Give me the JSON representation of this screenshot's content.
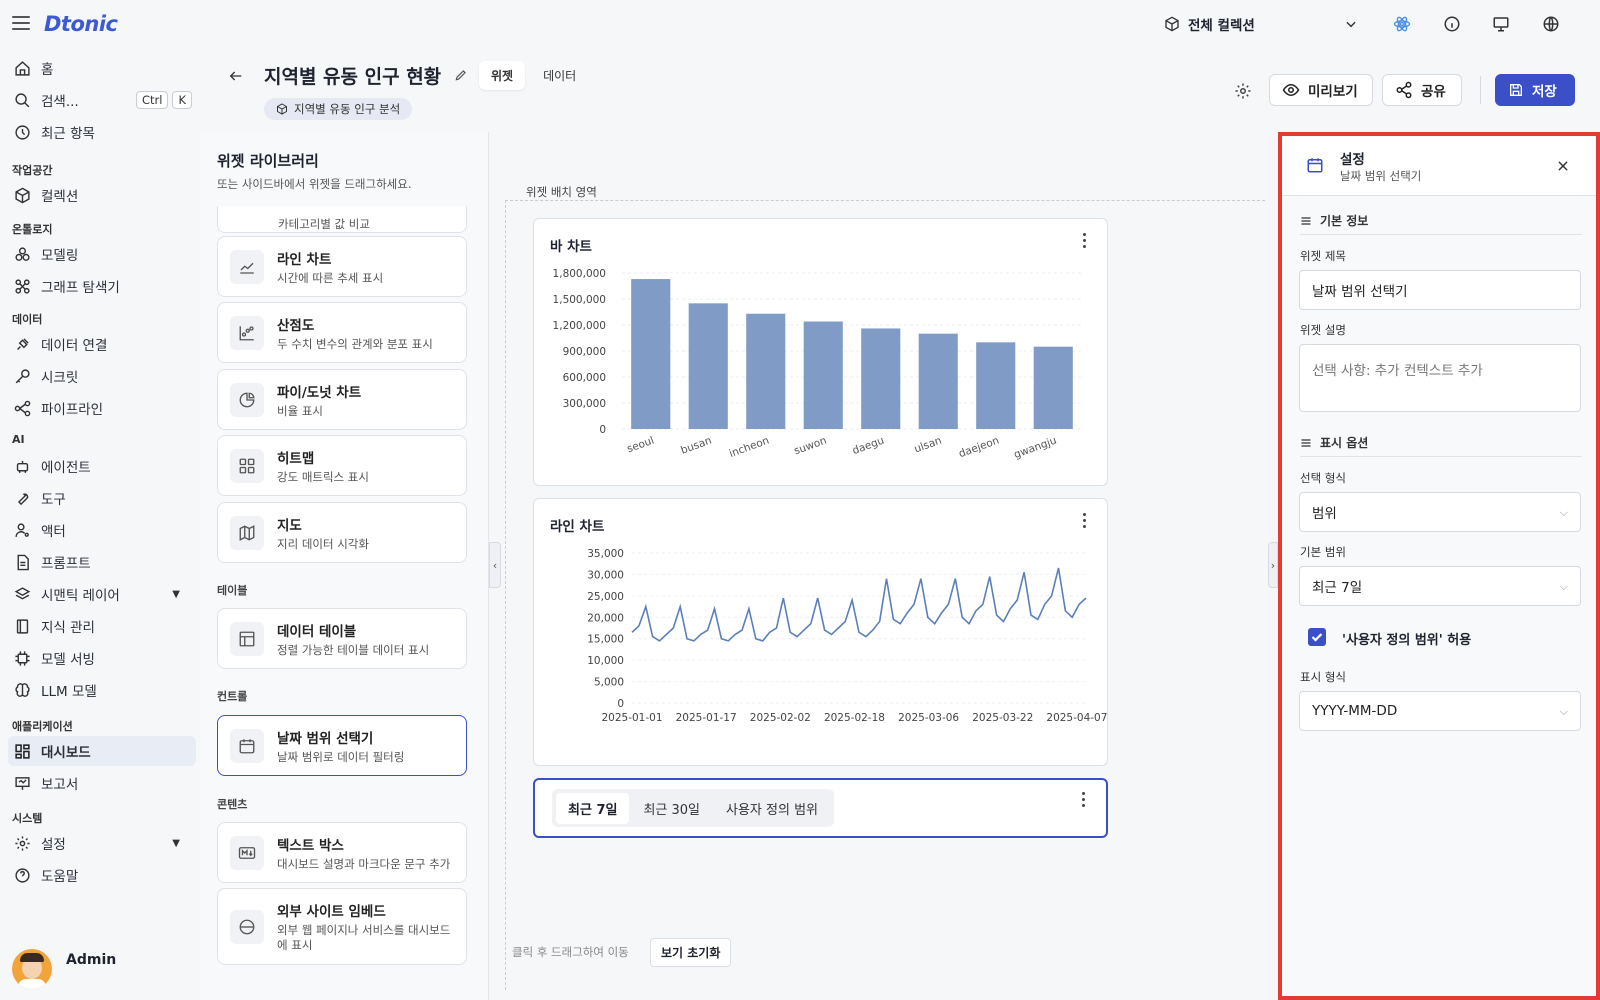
{
  "app": {
    "logo": "Dtonic"
  },
  "sidebar": {
    "home": "홈",
    "search": "검색...",
    "search_kbd": [
      "Ctrl",
      "K"
    ],
    "recent": "최근 항목",
    "sections": {
      "workspace": "작업공간",
      "ontology": "온톨로지",
      "data": "데이터",
      "ai": "AI",
      "application": "애플리케이션",
      "system": "시스템"
    },
    "items": {
      "collection": "컬렉션",
      "modeling": "모델링",
      "graph": "그래프 탐색기",
      "dataconn": "데이터 연결",
      "secret": "시크릿",
      "pipeline": "파이프라인",
      "agent": "에이전트",
      "tool": "도구",
      "actor": "액터",
      "prompt": "프롬프트",
      "semantic": "시맨틱 레이어",
      "knowledge": "지식 관리",
      "serving": "모델 서빙",
      "llm": "LLM 모델",
      "dashboard": "대시보드",
      "report": "보고서",
      "settings": "설정",
      "help": "도움말"
    },
    "user": "Admin"
  },
  "topbar": {
    "collection": "전체 컬렉션"
  },
  "header": {
    "title": "지역별 유동 인구 현황",
    "tab_widget": "위젯",
    "tab_data": "데이터",
    "tag": "지역별 유동 인구 분석",
    "preview": "미리보기",
    "share": "공유",
    "save": "저장"
  },
  "library": {
    "title": "위젯 라이브러리",
    "subtitle": "또는 사이드바에서 위젯을 드래그하세요.",
    "partial_desc": "카테고리별 값 비교",
    "line": {
      "name": "라인 차트",
      "desc": "시간에 따른 추세 표시"
    },
    "scatter": {
      "name": "산점도",
      "desc": "두 수치 변수의 관계와 분포 표시"
    },
    "pie": {
      "name": "파이/도넛 차트",
      "desc": "비율 표시"
    },
    "heatmap": {
      "name": "히트맵",
      "desc": "강도 매트릭스 표시"
    },
    "map": {
      "name": "지도",
      "desc": "지리 데이터 시각화"
    },
    "g_table": "테이블",
    "table": {
      "name": "데이터 테이블",
      "desc": "정렬 가능한 테이블 데이터 표시"
    },
    "g_control": "컨트롤",
    "date": {
      "name": "날짜 범위 선택기",
      "desc": "날짜 범위로 데이터 필터링"
    },
    "g_content": "콘텐츠",
    "text": {
      "name": "텍스트 박스",
      "desc": "대시보드 설명과 마크다운 문구 추가"
    },
    "embed": {
      "name": "외부 사이트 임베드",
      "desc": "외부 웹 페이지나 서비스를 대시보드에 표시"
    }
  },
  "canvas": {
    "area_label": "위젯 배치 영역",
    "hint": "클릭 후 드래그하여 이동",
    "reset": "보기 초기화",
    "range_tabs": [
      "최근 7일",
      "최근 30일",
      "사용자 정의 범위"
    ]
  },
  "chart_data": [
    {
      "type": "bar",
      "title": "바 차트",
      "categories": [
        "seoul",
        "busan",
        "incheon",
        "suwon",
        "daegu",
        "ulsan",
        "daejeon",
        "gwangju"
      ],
      "values": [
        1730000,
        1450000,
        1330000,
        1240000,
        1160000,
        1100000,
        1000000,
        950000
      ],
      "ylim": [
        0,
        1800000
      ],
      "yticks": [
        "0",
        "300,000",
        "600,000",
        "900,000",
        "1,200,000",
        "1,500,000",
        "1,800,000"
      ],
      "color": "#7f9bc6"
    },
    {
      "type": "line",
      "title": "라인 차트",
      "xticks": [
        "2025-01-01",
        "2025-01-17",
        "2025-02-02",
        "2025-02-18",
        "2025-03-06",
        "2025-03-22",
        "2025-04-07"
      ],
      "yticks": [
        "0",
        "5,000",
        "10,000",
        "15,000",
        "20,000",
        "25,000",
        "30,000",
        "35,000"
      ],
      "ylim": [
        0,
        35000
      ],
      "values": [
        16500,
        18000,
        22500,
        15500,
        14500,
        16000,
        17500,
        22500,
        15000,
        14500,
        16000,
        17000,
        22000,
        15000,
        14500,
        16000,
        17000,
        22000,
        15000,
        14500,
        16500,
        17500,
        24500,
        16500,
        15500,
        17000,
        18500,
        24500,
        17000,
        16000,
        17500,
        19000,
        24000,
        16500,
        15500,
        17000,
        19000,
        29000,
        19500,
        18500,
        21000,
        23000,
        29000,
        20000,
        18500,
        21000,
        23000,
        29000,
        20000,
        18500,
        21500,
        23000,
        29500,
        20500,
        19000,
        22000,
        24000,
        30500,
        20500,
        19500,
        23000,
        25000,
        31500,
        21500,
        20000,
        23000,
        24500
      ]
    }
  ],
  "settings": {
    "title": "설정",
    "subtitle": "날짜 범위 선택기",
    "basic": "기본 정보",
    "w_title_label": "위젯 제목",
    "w_title_value": "날짜 범위 선택기",
    "w_desc_label": "위젯 설명",
    "w_desc_placeholder": "선택 사항: 추가 컨텍스트 추가",
    "display": "표시 옵션",
    "sel_label": "선택 형식",
    "sel_value": "범위",
    "range_label": "기본 범위",
    "range_value": "최근 7일",
    "custom_label": "'사용자 정의 범위' 허용",
    "custom_checked": true,
    "fmt_label": "표시 형식",
    "fmt_value": "YYYY-MM-DD"
  }
}
